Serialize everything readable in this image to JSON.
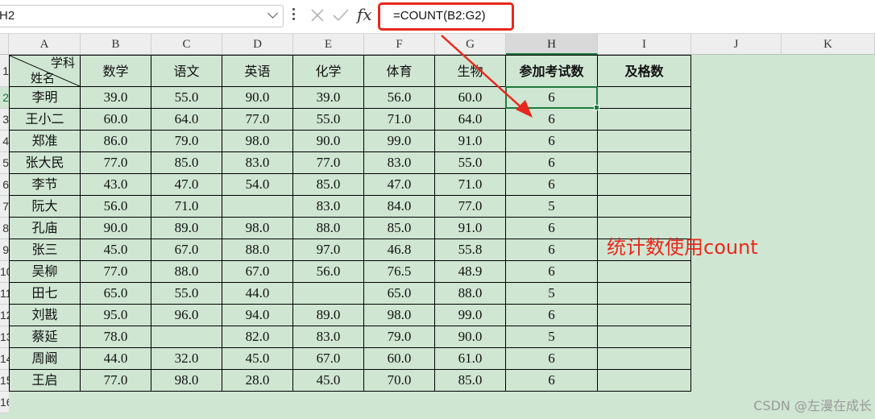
{
  "formula_bar": {
    "name_box": "H2",
    "cancel_icon": "cancel-icon",
    "enter_icon": "checkmark-icon",
    "fx_label": "fx",
    "formula": "=COUNT(B2:G2)"
  },
  "columns": [
    "A",
    "B",
    "C",
    "D",
    "E",
    "F",
    "G",
    "H",
    "I",
    "J",
    "K"
  ],
  "rows": [
    "1",
    "2",
    "3",
    "4",
    "5",
    "6",
    "7",
    "8",
    "9",
    "10",
    "11",
    "12",
    "13",
    "14",
    "15",
    "16"
  ],
  "table": {
    "corner_top": "学科",
    "corner_bottom": "姓名",
    "headers": [
      "数学",
      "语文",
      "英语",
      "化学",
      "体育",
      "生物",
      "参加考试数",
      "及格数"
    ],
    "students": [
      {
        "name": "李明",
        "scores": [
          "39.0",
          "55.0",
          "90.0",
          "39.0",
          "56.0",
          "60.0"
        ],
        "count": "6"
      },
      {
        "name": "王小二",
        "scores": [
          "60.0",
          "64.0",
          "77.0",
          "55.0",
          "71.0",
          "64.0"
        ],
        "count": "6"
      },
      {
        "name": "郑准",
        "scores": [
          "86.0",
          "79.0",
          "98.0",
          "90.0",
          "99.0",
          "91.0"
        ],
        "count": "6"
      },
      {
        "name": "张大民",
        "scores": [
          "77.0",
          "85.0",
          "83.0",
          "77.0",
          "83.0",
          "55.0"
        ],
        "count": "6"
      },
      {
        "name": "李节",
        "scores": [
          "43.0",
          "47.0",
          "54.0",
          "85.0",
          "47.0",
          "71.0"
        ],
        "count": "6"
      },
      {
        "name": "阮大",
        "scores": [
          "56.0",
          "71.0",
          "",
          "83.0",
          "84.0",
          "77.0"
        ],
        "count": "5"
      },
      {
        "name": "孔庙",
        "scores": [
          "90.0",
          "89.0",
          "98.0",
          "88.0",
          "85.0",
          "91.0"
        ],
        "count": "6"
      },
      {
        "name": "张三",
        "scores": [
          "45.0",
          "67.0",
          "88.0",
          "97.0",
          "46.8",
          "55.8"
        ],
        "count": "6"
      },
      {
        "name": "吴柳",
        "scores": [
          "77.0",
          "88.0",
          "67.0",
          "56.0",
          "76.5",
          "48.9"
        ],
        "count": "6"
      },
      {
        "name": "田七",
        "scores": [
          "65.0",
          "55.0",
          "44.0",
          "",
          "65.0",
          "88.0"
        ],
        "count": "5"
      },
      {
        "name": "刘戡",
        "scores": [
          "95.0",
          "96.0",
          "94.0",
          "89.0",
          "98.0",
          "99.0"
        ],
        "count": "6"
      },
      {
        "name": "蔡延",
        "scores": [
          "78.0",
          "",
          "82.0",
          "83.0",
          "79.0",
          "90.0"
        ],
        "count": "5"
      },
      {
        "name": "周阚",
        "scores": [
          "44.0",
          "32.0",
          "45.0",
          "67.0",
          "60.0",
          "61.0"
        ],
        "count": "6"
      },
      {
        "name": "王启",
        "scores": [
          "77.0",
          "98.0",
          "28.0",
          "45.0",
          "70.0",
          "85.0"
        ],
        "count": "6"
      }
    ]
  },
  "annotation": "统计数使用count",
  "watermark": "CSDN @左漫在成长",
  "colors": {
    "highlight": "#e8281c",
    "sheet_bg": "#cfe6d2",
    "selection": "#1f7a3d"
  }
}
